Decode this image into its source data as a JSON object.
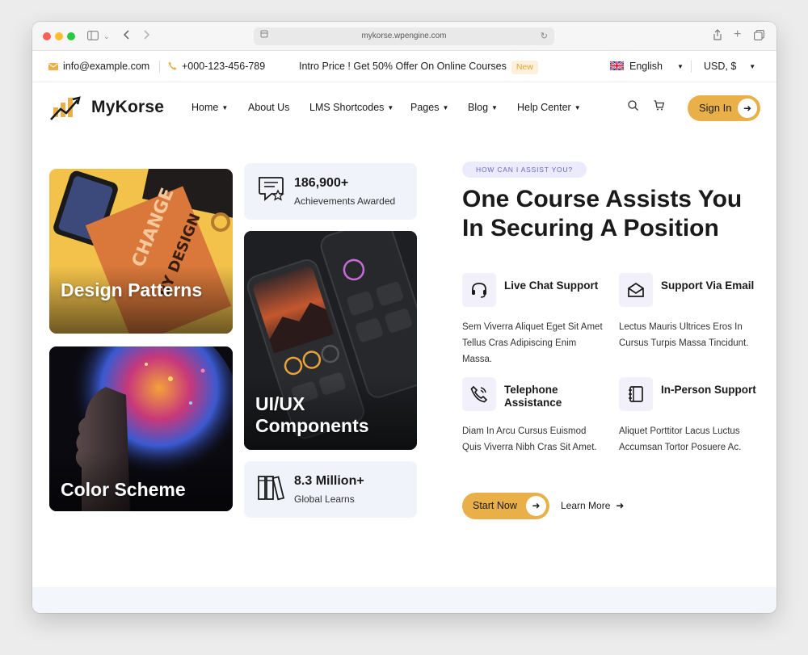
{
  "browser": {
    "url": "mykorse.wpengine.com"
  },
  "topbar": {
    "email": "info@example.com",
    "phone": "+000-123-456-789",
    "promo": "Intro Price ! Get 50% Offer On Online Courses",
    "promo_badge": "New",
    "language": "English",
    "currency": "USD, $"
  },
  "header": {
    "logo_text": "MyKorse",
    "nav": [
      "Home",
      "About Us",
      "LMS Shortcodes",
      "Pages",
      "Blog",
      "Help Center"
    ],
    "signin_label": "Sign In"
  },
  "cards": {
    "design": "Design Patterns",
    "color": "Color Scheme",
    "uiux": "UI/UX Components"
  },
  "stats": [
    {
      "num": "186,900+",
      "label": "Achievements Awarded"
    },
    {
      "num": "8.3 Million+",
      "label": "Global Learns"
    }
  ],
  "hero": {
    "eyebrow": "HOW CAN I ASSIST YOU?",
    "headline": "One Course Assists You In Securing A Position",
    "features": [
      {
        "title": "Live Chat Support",
        "desc": "Sem Viverra Aliquet Eget Sit Amet Tellus Cras Adipiscing Enim Massa."
      },
      {
        "title": "Support Via Email",
        "desc": "Lectus Mauris Ultrices Eros In Cursus Turpis Massa Tincidunt."
      },
      {
        "title": "Telephone Assistance",
        "desc": "Diam In Arcu Cursus Euismod Quis Viverra Nibh Cras Sit Amet."
      },
      {
        "title": "In-Person Support",
        "desc": "Aliquet Porttitor Lacus Luctus Accumsan Tortor Posuere Ac."
      }
    ],
    "start_label": "Start Now",
    "learn_label": "Learn More"
  },
  "colors": {
    "accent": "#e9b04a",
    "pill_bg": "#ecebfb",
    "pill_text": "#6b63c9"
  }
}
